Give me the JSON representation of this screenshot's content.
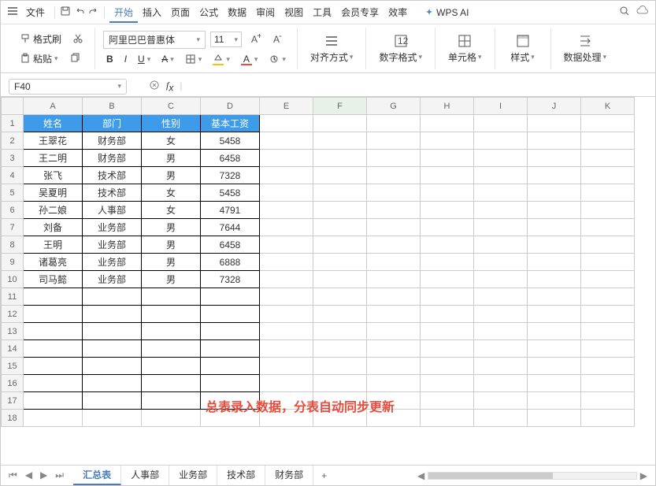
{
  "menubar": {
    "file": "文件",
    "tabs": [
      "开始",
      "插入",
      "页面",
      "公式",
      "数据",
      "审阅",
      "视图",
      "工具",
      "会员专享",
      "效率"
    ],
    "wpsai": "WPS AI"
  },
  "ribbon": {
    "format_painter": "格式刷",
    "paste": "粘贴",
    "font_name": "阿里巴巴普惠体",
    "font_size": "11",
    "align": "对齐方式",
    "number": "数字格式",
    "cells": "单元格",
    "styles": "样式",
    "data": "数据处理"
  },
  "namebox": {
    "ref": "F40"
  },
  "columns": [
    "A",
    "B",
    "C",
    "D",
    "E",
    "F",
    "G",
    "H",
    "I",
    "J",
    "K"
  ],
  "headers": [
    "姓名",
    "部门",
    "性别",
    "基本工资"
  ],
  "rows": [
    [
      "王翠花",
      "财务部",
      "女",
      "5458"
    ],
    [
      "王二明",
      "财务部",
      "男",
      "6458"
    ],
    [
      "张飞",
      "技术部",
      "男",
      "7328"
    ],
    [
      "吴夏明",
      "技术部",
      "女",
      "5458"
    ],
    [
      "孙二娘",
      "人事部",
      "女",
      "4791"
    ],
    [
      "刘备",
      "业务部",
      "男",
      "7644"
    ],
    [
      "王明",
      "业务部",
      "男",
      "6458"
    ],
    [
      "诸葛亮",
      "业务部",
      "男",
      "6888"
    ],
    [
      "司马懿",
      "业务部",
      "男",
      "7328"
    ]
  ],
  "annotation": "总表录入数据，分表自动同步更新",
  "sheets": [
    "汇总表",
    "人事部",
    "业务部",
    "技术部",
    "财务部"
  ],
  "tabadd": "+"
}
